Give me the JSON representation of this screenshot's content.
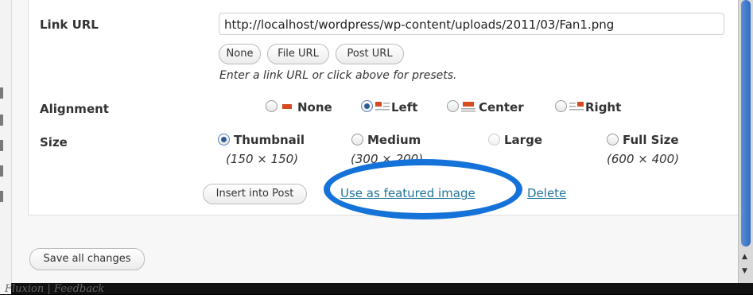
{
  "form": {
    "link_url": {
      "label": "Link URL",
      "value": "http://localhost/wordpress/wp-content/uploads/2011/03/Fan1.png",
      "buttons": [
        "None",
        "File URL",
        "Post URL"
      ],
      "hint": "Enter a link URL or click above for presets."
    },
    "alignment": {
      "label": "Alignment",
      "options": [
        {
          "label": "None",
          "selected": false
        },
        {
          "label": "Left",
          "selected": true
        },
        {
          "label": "Center",
          "selected": false
        },
        {
          "label": "Right",
          "selected": false
        }
      ]
    },
    "size": {
      "label": "Size",
      "options": [
        {
          "label": "Thumbnail",
          "dims": "(150 × 150)",
          "selected": true,
          "enabled": true
        },
        {
          "label": "Medium",
          "dims": "(300 × 200)",
          "selected": false,
          "enabled": true
        },
        {
          "label": "Large",
          "dims": "",
          "selected": false,
          "enabled": false
        },
        {
          "label": "Full Size",
          "dims": "(600 × 400)",
          "selected": false,
          "enabled": true
        }
      ]
    },
    "actions": {
      "insert_label": "Insert into Post",
      "featured_label": "Use as featured image",
      "delete_label": "Delete"
    }
  },
  "footer": {
    "save_label": "Save all changes"
  },
  "background": {
    "credit": "Fluxion | Feedback"
  },
  "colors": {
    "link": "#21759b",
    "highlight": "#1472d8",
    "scroll_thumb": "#2f6bc2"
  }
}
